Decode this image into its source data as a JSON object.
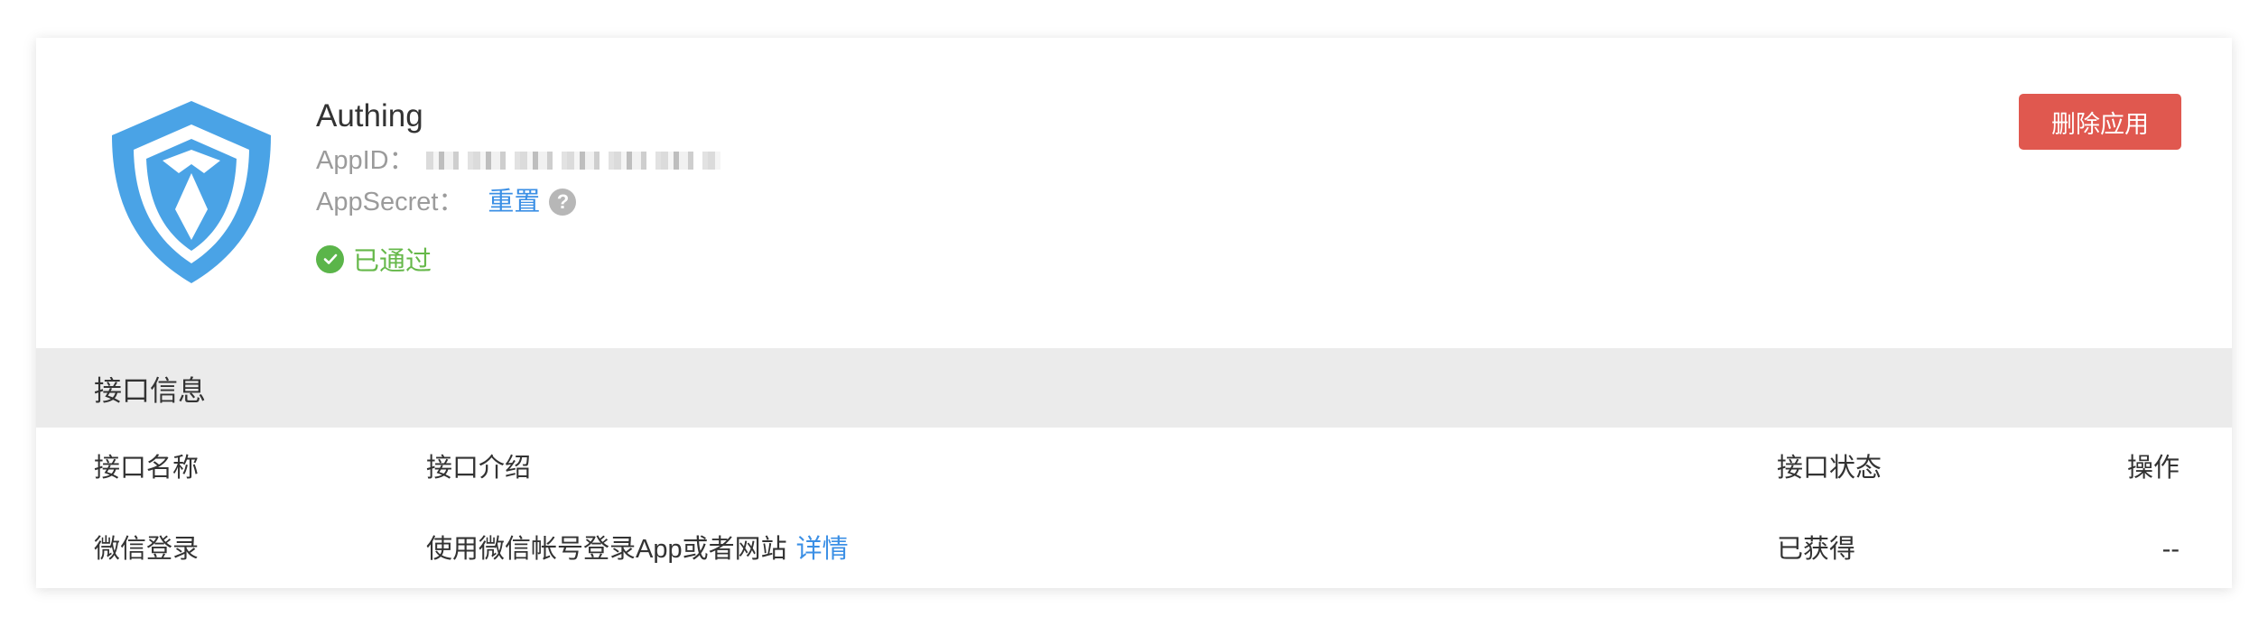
{
  "app": {
    "name": "Authing",
    "appid_label": "AppID：",
    "appsecret_label": "AppSecret：",
    "reset_label": "重置",
    "help_glyph": "?",
    "status_text": "已通过",
    "delete_button_label": "删除应用"
  },
  "colors": {
    "accent_link": "#3b8fe5",
    "danger_button": "#e0584f",
    "success": "#5bb54a",
    "logo_blue": "#4aa3e6",
    "section_bg": "#ebebeb"
  },
  "api_section": {
    "title": "接口信息",
    "columns": [
      "接口名称",
      "接口介绍",
      "接口状态",
      "操作"
    ],
    "rows": [
      {
        "name": "微信登录",
        "description": "使用微信帐号登录App或者网站",
        "detail_link": "详情",
        "status": "已获得",
        "action": "--"
      }
    ]
  }
}
